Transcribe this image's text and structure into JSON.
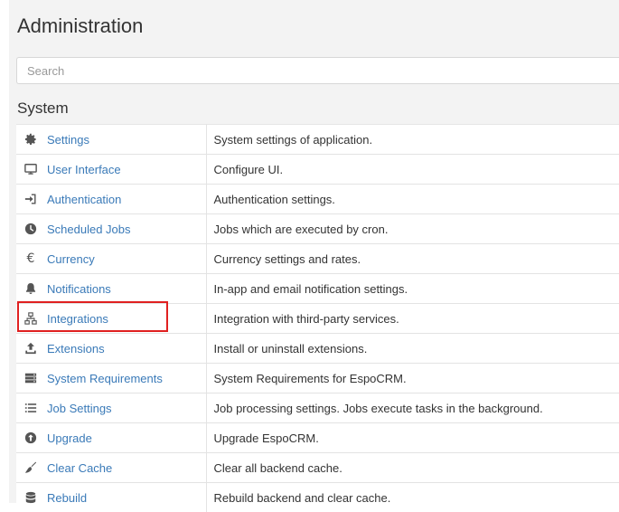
{
  "page": {
    "title": "Administration"
  },
  "search": {
    "placeholder": "Search"
  },
  "section": {
    "title": "System"
  },
  "items": [
    {
      "label": "Settings",
      "icon": "gear-icon",
      "description": "System settings of application."
    },
    {
      "label": "User Interface",
      "icon": "monitor-icon",
      "description": "Configure UI."
    },
    {
      "label": "Authentication",
      "icon": "sign-in-icon",
      "description": "Authentication settings."
    },
    {
      "label": "Scheduled Jobs",
      "icon": "clock-icon",
      "description": "Jobs which are executed by cron."
    },
    {
      "label": "Currency",
      "icon": "euro-icon",
      "description": "Currency settings and rates."
    },
    {
      "label": "Notifications",
      "icon": "bell-icon",
      "description": "In-app and email notification settings."
    },
    {
      "label": "Integrations",
      "icon": "network-icon",
      "description": "Integration with third-party services."
    },
    {
      "label": "Extensions",
      "icon": "upload-icon",
      "description": "Install or uninstall extensions."
    },
    {
      "label": "System Requirements",
      "icon": "server-icon",
      "description": "System Requirements for EspoCRM."
    },
    {
      "label": "Job Settings",
      "icon": "list-icon",
      "description": "Job processing settings. Jobs execute tasks in the background."
    },
    {
      "label": "Upgrade",
      "icon": "arrow-up-circle-icon",
      "description": "Upgrade EspoCRM."
    },
    {
      "label": "Clear Cache",
      "icon": "broom-icon",
      "description": "Clear all backend cache."
    },
    {
      "label": "Rebuild",
      "icon": "database-icon",
      "description": "Rebuild backend and clear cache."
    }
  ],
  "highlight_color": "#e02020",
  "link_color": "#3a7ab8"
}
